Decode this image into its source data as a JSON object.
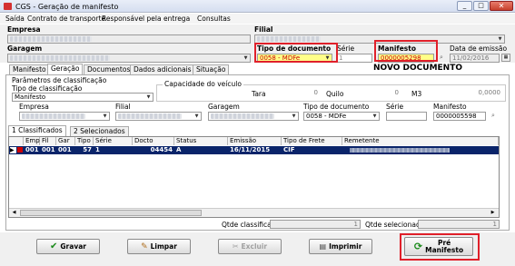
{
  "window": {
    "title": "CGS - Geração de manifesto"
  },
  "menu": [
    "Saída",
    "Contrato de transporte",
    "Responsável pela entrega",
    "Consultas"
  ],
  "header": {
    "empresa_label": "Empresa",
    "filial_label": "Filial",
    "garagem_label": "Garagem",
    "tipo_documento_label": "Tipo de documento",
    "tipo_documento_value": "0058 - MDFe",
    "serie_label": "Série",
    "serie_value": "1",
    "manifesto_label": "Manifesto",
    "manifesto_value": "0000005298",
    "data_emissao_label": "Data de emissão",
    "data_emissao_value": "11/02/2016",
    "status_text": "NOVO DOCUMENTO"
  },
  "tabs": [
    "Manifesto",
    "Geração",
    "Documentos",
    "Dados adicionais",
    "Situação"
  ],
  "params": {
    "group_label": "Parâmetros de classificação",
    "tipo_classificacao_label": "Tipo de classificação",
    "tipo_classificacao_value": "Manifesto",
    "capacidade_label": "Capacidade do veículo",
    "tara_label": "Tara",
    "tara_value": "0",
    "quilo_label": "Quilo",
    "quilo_value": "0",
    "m3_label": "M3",
    "m3_value": "0,0000",
    "empresa_label": "Empresa",
    "filial_label": "Filial",
    "garagem_label": "Garagem",
    "tipo_documento_label": "Tipo de documento",
    "tipo_documento_value": "0058 - MDFe",
    "serie_label": "Série",
    "manifesto_label": "Manifesto",
    "manifesto_value": "0000005598"
  },
  "subtabs": [
    "1 Classificados",
    "2 Selecionados"
  ],
  "grid": {
    "columns": [
      "Emp",
      "Fil",
      "Gar",
      "Tipo",
      "Série",
      "Docto",
      "Status",
      "Emissão",
      "Tipo de Frete",
      "Remetente"
    ],
    "rows": [
      {
        "emp": "001",
        "fil": "001",
        "gar": "001",
        "tipo": "57",
        "serie": "1",
        "docto": "04454",
        "status": "A",
        "emissao": "16/11/2015",
        "frete": "CIF"
      }
    ]
  },
  "footer": {
    "qtde_classificados_label": "Qtde classificados",
    "qtde_classificados_value": "1",
    "qtde_selecionados_label": "Qtde selecionados",
    "qtde_selecionados_value": "1"
  },
  "buttons": {
    "gravar": "Gravar",
    "limpar": "Limpar",
    "excluir": "Excluir",
    "imprimir": "Imprimir",
    "pre_manifesto_line1": "Pré",
    "pre_manifesto_line2": "Manifesto"
  },
  "colors": {
    "highlight_red": "#e0202a",
    "selection_blue": "#0a246a",
    "yellow_field": "#ffff88"
  }
}
